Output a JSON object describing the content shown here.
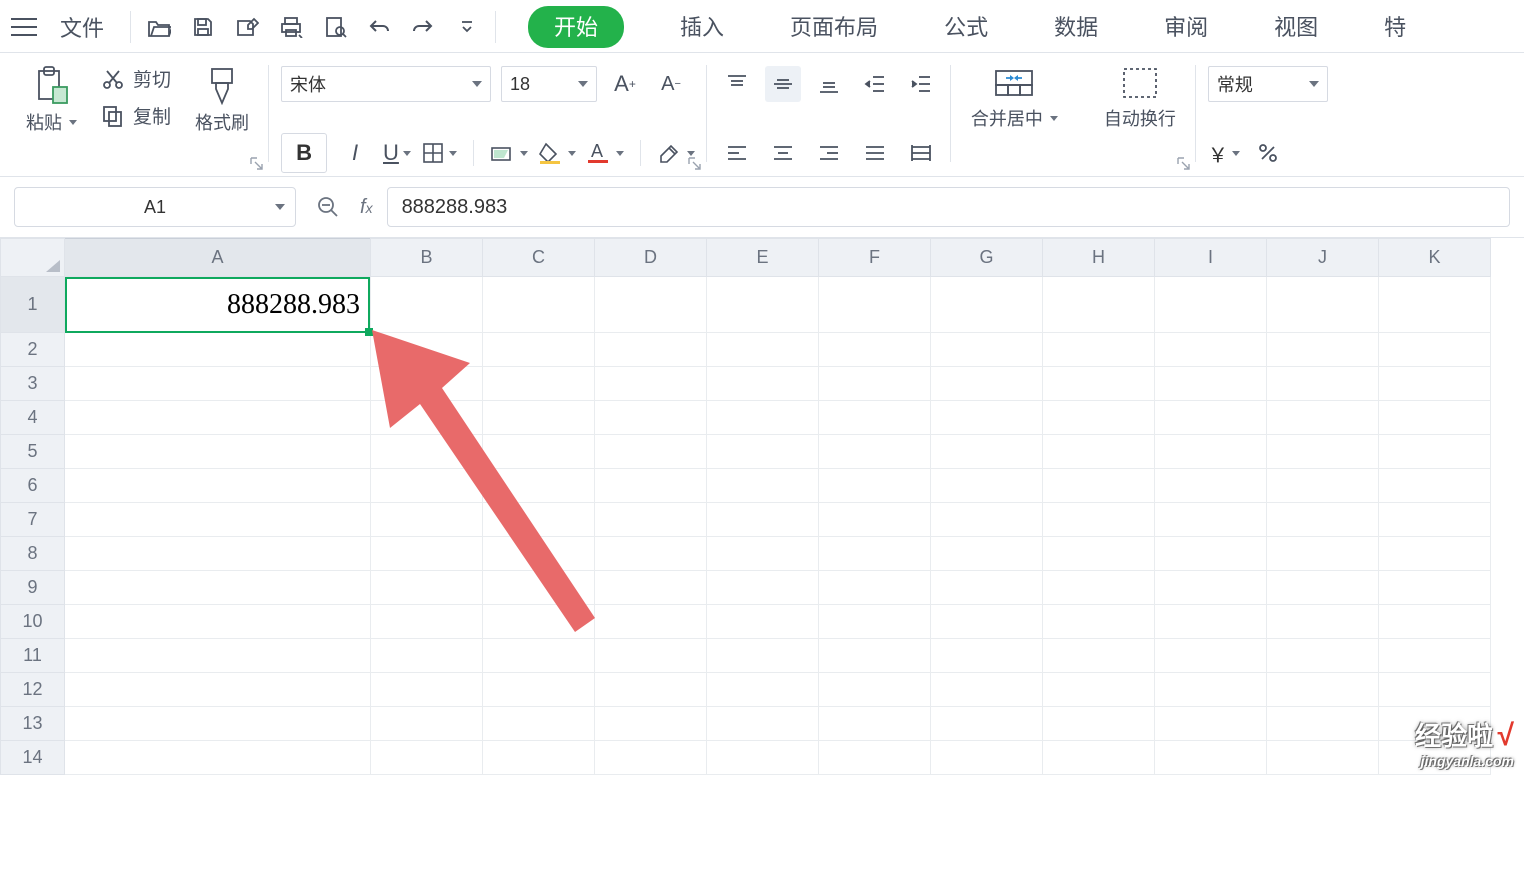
{
  "menu": {
    "file": "文件"
  },
  "tabs": [
    "开始",
    "插入",
    "页面布局",
    "公式",
    "数据",
    "审阅",
    "视图",
    "特"
  ],
  "clipboard": {
    "paste": "粘贴",
    "cut": "剪切",
    "copy": "复制",
    "format_painter": "格式刷"
  },
  "font": {
    "name": "宋体",
    "size": "18",
    "bold": "B",
    "italic": "I",
    "underline": "U"
  },
  "align": {
    "merge_center": "合并居中",
    "wrap_text": "自动换行"
  },
  "number": {
    "format": "常规",
    "currency": "￥"
  },
  "name_box": "A1",
  "formula_value": "888288.983",
  "cell_value": "888288.983",
  "columns": [
    "A",
    "B",
    "C",
    "D",
    "E",
    "F",
    "G",
    "H",
    "I",
    "J",
    "K"
  ],
  "rows": [
    "1",
    "2",
    "3",
    "4",
    "5",
    "6",
    "7",
    "8",
    "9",
    "10",
    "11",
    "12",
    "13",
    "14"
  ],
  "watermark": {
    "line1": "经验啦",
    "check": "√",
    "line2": "jingyanla.com"
  },
  "font_big": {
    "A+": "A",
    "A-": "A"
  }
}
